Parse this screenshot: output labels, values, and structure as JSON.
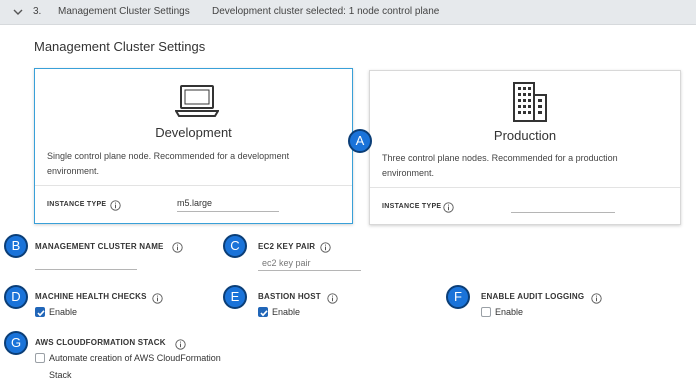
{
  "step_header": {
    "number": "3.",
    "title": "Management Cluster Settings",
    "summary": "Development cluster selected: 1 node control plane"
  },
  "section_title": "Management Cluster Settings",
  "cards": {
    "development": {
      "title": "Development",
      "description": "Single control plane node. Recommended for a development environment.",
      "instance_type_label": "INSTANCE TYPE",
      "instance_type_value": "m5.large",
      "selected": true
    },
    "production": {
      "title": "Production",
      "description": "Three control plane nodes. Recommended for a production environment.",
      "instance_type_label": "INSTANCE TYPE",
      "instance_type_value": "",
      "selected": false
    }
  },
  "callouts": {
    "a": "A",
    "b": "B",
    "c": "C",
    "d": "D",
    "e": "E",
    "f": "F",
    "g": "G"
  },
  "fields": {
    "management_cluster_name": {
      "label": "MANAGEMENT CLUSTER NAME",
      "value": ""
    },
    "ec2_key_pair": {
      "label": "EC2 KEY PAIR",
      "placeholder": "ec2 key pair"
    },
    "machine_health_checks": {
      "label": "MACHINE HEALTH CHECKS",
      "checkbox_label": "Enable",
      "checked": true
    },
    "bastion_host": {
      "label": "BASTION HOST",
      "checkbox_label": "Enable",
      "checked": true
    },
    "enable_audit_logging": {
      "label": "ENABLE AUDIT LOGGING",
      "checkbox_label": "Enable",
      "checked": false
    },
    "aws_cloudformation_stack": {
      "label": "AWS CLOUDFORMATION STACK",
      "checkbox_label_line1": "Automate creation of AWS CloudFormation",
      "checkbox_label_line2": "Stack",
      "checked": false
    }
  },
  "colors": {
    "header_bg": "#e6e9ec",
    "selected_border": "#39a0d8",
    "callout_fill": "#1a73d9",
    "callout_border": "#0b3e77",
    "checkbox_checked": "#2166b8"
  },
  "icons": {
    "header_toggle": "chevron-down-icon",
    "development": "laptop-icon",
    "production": "buildings-icon",
    "info": "info-icon",
    "checkbox_mark": "checkmark-icon"
  }
}
